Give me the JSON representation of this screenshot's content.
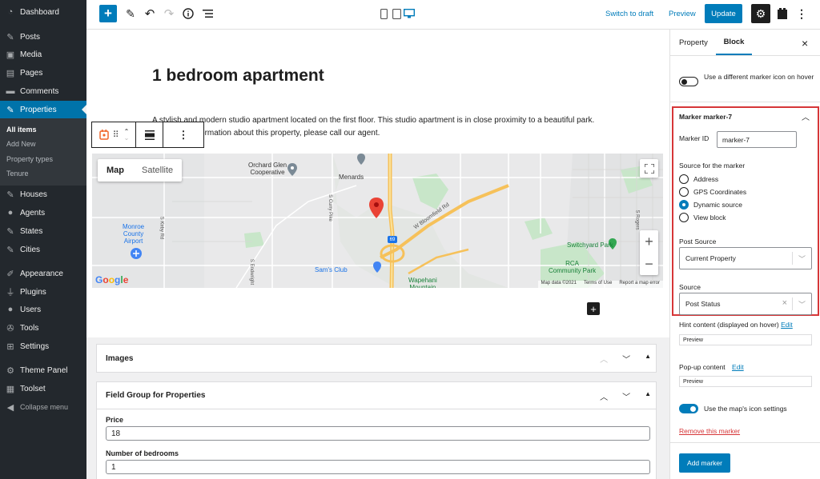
{
  "admin_menu": {
    "items": [
      {
        "label": "Dashboard",
        "icon": "dashboard-icon"
      },
      {
        "label": "Posts",
        "icon": "pin-icon"
      },
      {
        "label": "Media",
        "icon": "media-icon"
      },
      {
        "label": "Pages",
        "icon": "pages-icon"
      },
      {
        "label": "Comments",
        "icon": "comments-icon"
      },
      {
        "label": "Properties",
        "icon": "pin-icon"
      },
      {
        "label": "Houses",
        "icon": "pin-icon"
      },
      {
        "label": "Agents",
        "icon": "users-icon"
      },
      {
        "label": "States",
        "icon": "pin-icon"
      },
      {
        "label": "Cities",
        "icon": "pin-icon"
      },
      {
        "label": "Appearance",
        "icon": "brush-icon"
      },
      {
        "label": "Plugins",
        "icon": "plugin-icon"
      },
      {
        "label": "Users",
        "icon": "users-icon"
      },
      {
        "label": "Tools",
        "icon": "wrench-icon"
      },
      {
        "label": "Settings",
        "icon": "settings-icon"
      },
      {
        "label": "Theme Panel",
        "icon": "gear-icon"
      },
      {
        "label": "Toolset",
        "icon": "toolset-icon"
      },
      {
        "label": "Collapse menu",
        "icon": "collapse-icon"
      }
    ],
    "submenu": [
      "All items",
      "Add New",
      "Property types",
      "Tenure"
    ]
  },
  "topbar": {
    "switch_to_draft": "Switch to draft",
    "preview": "Preview",
    "update": "Update"
  },
  "post": {
    "title": "1 bedroom apartment",
    "paragraph": "A stylish and modern studio apartment located on the first floor. This studio apartment is in close proximity to a beautiful park. For further information about this property, please call our agent."
  },
  "map": {
    "tab_map": "Map",
    "tab_satellite": "Satellite",
    "labels": {
      "menards": "Menards",
      "orchard_glen": "Orchard Glen\nCooperative",
      "monroe_county": "Monroe\nCounty\nAirport",
      "switchyard": "Switchyard Park",
      "rca": "RCA\nCommunity Park",
      "sams_club": "Sam's Club",
      "wapehani": "Wapehani\nMountain",
      "bloomfield": "W Bloomfield Rd",
      "curry": "S Curry Pike",
      "kirby": "S Kirby Rd",
      "endwright": "S Endwright",
      "rogers": "S Rogers",
      "hwy": "69"
    },
    "logo": "Google",
    "footer": [
      "Map data ©2021",
      "Terms of Use",
      "Report a map error"
    ]
  },
  "metabox": {
    "images_title": "Images",
    "field_group_title": "Field Group for Properties",
    "price_label": "Price",
    "price_value": "18",
    "bedrooms_label": "Number of bedrooms",
    "bedrooms_value": "1"
  },
  "sidebar": {
    "tab_property": "Property",
    "tab_block": "Block",
    "toggle_hover_label": "Use a different marker icon on hover",
    "marker_panel_title": "Marker marker-7",
    "marker_id_label": "Marker ID",
    "marker_id_value": "marker-7",
    "source_label": "Source for the marker",
    "sources": [
      "Address",
      "GPS Coordinates",
      "Dynamic source",
      "View block"
    ],
    "selected_source": "Dynamic source",
    "post_source_label": "Post Source",
    "post_source_value": "Current Property",
    "source2_label": "Source",
    "source2_value": "Post Status",
    "hint_label": "Hint content (displayed on hover)",
    "hint_edit": "Edit",
    "hint_preview": "Preview",
    "popup_label": "Pop-up content",
    "popup_edit": "Edit",
    "popup_preview": "Preview",
    "icon_settings_label": "Use the map's icon settings",
    "remove_marker": "Remove this marker",
    "add_marker": "Add marker"
  },
  "colors": {
    "admin_bg": "#23282d",
    "accent": "#007cba",
    "highlight": "#d63638",
    "remove_link": "#d63638",
    "marker_red": "#ea4335",
    "park_green": "#34a853"
  }
}
